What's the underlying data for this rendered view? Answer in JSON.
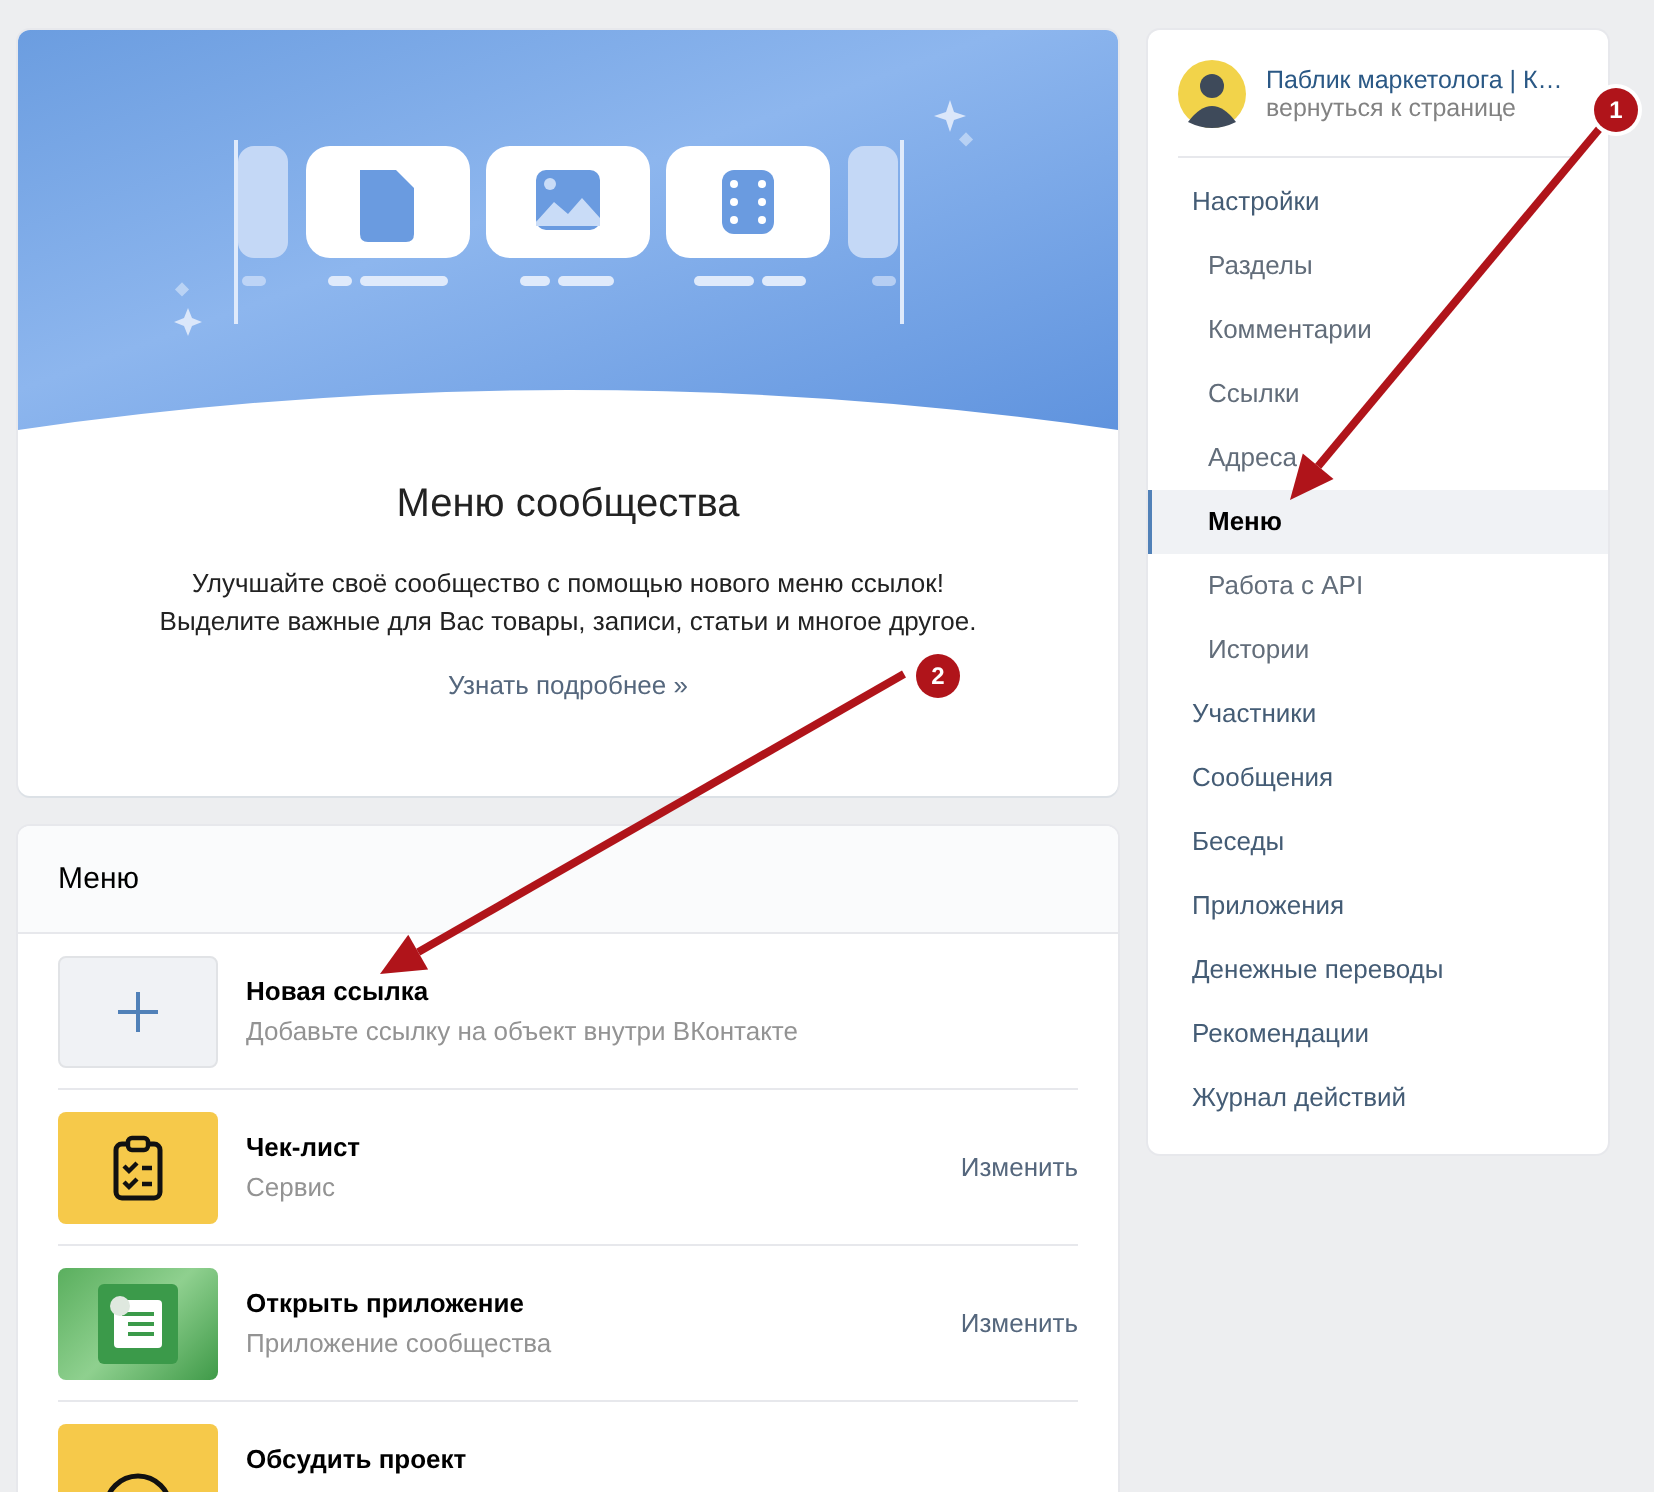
{
  "hero": {
    "title": "Меню сообщества",
    "description_lines": [
      "Улучшайте своё сообщество с помощью нового меню ссылок!",
      "Выделите важные для Вас товары, записи, статьи и многое другое."
    ],
    "link": "Узнать подробнее »"
  },
  "menu": {
    "title": "Меню",
    "items": [
      {
        "kind": "add",
        "title": "Новая ссылка",
        "subtitle": "Добавьте ссылку на объект внутри ВКонтакте"
      },
      {
        "kind": "checklist",
        "title": "Чек-лист",
        "subtitle": "Сервис",
        "action": "Изменить"
      },
      {
        "kind": "app",
        "title": "Открыть приложение",
        "subtitle": "Приложение сообщества",
        "action": "Изменить"
      },
      {
        "kind": "discussion",
        "title": "Обсудить проект"
      }
    ]
  },
  "sidebar": {
    "community": {
      "name": "Паблик маркетолога | К…",
      "link": "вернуться к странице"
    },
    "items": [
      {
        "label": "Настройки",
        "selected": false,
        "children": [
          {
            "label": "Разделы",
            "selected": false
          },
          {
            "label": "Комментарии",
            "selected": false
          },
          {
            "label": "Ссылки",
            "selected": false
          },
          {
            "label": "Адреса",
            "selected": false
          },
          {
            "label": "Меню",
            "selected": true
          },
          {
            "label": "Работа с API",
            "selected": false
          },
          {
            "label": "Истории",
            "selected": false
          }
        ]
      },
      {
        "label": "Участники",
        "selected": false
      },
      {
        "label": "Сообщения",
        "selected": false
      },
      {
        "label": "Беседы",
        "selected": false
      },
      {
        "label": "Приложения",
        "selected": false
      },
      {
        "label": "Денежные переводы",
        "selected": false
      },
      {
        "label": "Рекомендации",
        "selected": false
      },
      {
        "label": "Журнал действий",
        "selected": false
      }
    ]
  },
  "annotations": [
    {
      "label": "1"
    },
    {
      "label": "2"
    }
  ]
}
